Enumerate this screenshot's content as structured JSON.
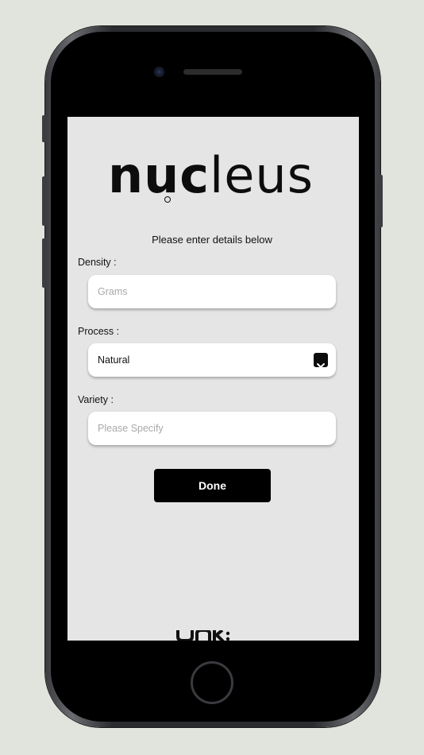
{
  "app": {
    "logo_text_bold": "nuc",
    "logo_text_light": "leus"
  },
  "form": {
    "subtitle": "Please enter details below",
    "density": {
      "label": "Density :",
      "placeholder": "Grams"
    },
    "process": {
      "label": "Process :",
      "value": "Natural"
    },
    "variety": {
      "label": "Variety :",
      "placeholder": "Please Specify"
    },
    "done_label": "Done"
  },
  "colors": {
    "screen_background": "#e5e5e5",
    "button_background": "#000000",
    "button_text": "#ffffff",
    "page_background": "#e1e4dc"
  },
  "icons": {
    "dropdown": "chevron-down-icon",
    "footer_logo": "brand-mark-icon"
  }
}
